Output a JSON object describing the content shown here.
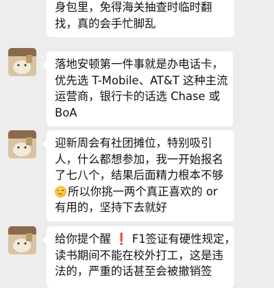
{
  "messages": [
    {
      "lines": [
        "身包里，免得海关抽查时临时翻",
        "找，真的会手忙脚乱"
      ]
    },
    {
      "lines": [
        "落地安顿第一件事就是办电话卡，",
        "优先选 T-Mobile、AT&T 这种主流",
        "运营商，银行卡的话选 Chase 或",
        "BoA"
      ]
    },
    {
      "lines": [
        "迎新周会有社团摊位，特别吸引",
        "人，什么都想参加，我一开始报名",
        "了七八个，结果后面精力根本不够",
        "所以你挑一两个真正喜欢的 or",
        "有用的，坚持下去就好"
      ]
    },
    {
      "line1_before": "给你提个醒",
      "line1_excl": "❗",
      "line1_after": "F1签证有硬性规定，",
      "lines": [
        "读书期间不能在校外打工，这是违",
        "法的，严重的话甚至会被撤销签"
      ]
    }
  ]
}
